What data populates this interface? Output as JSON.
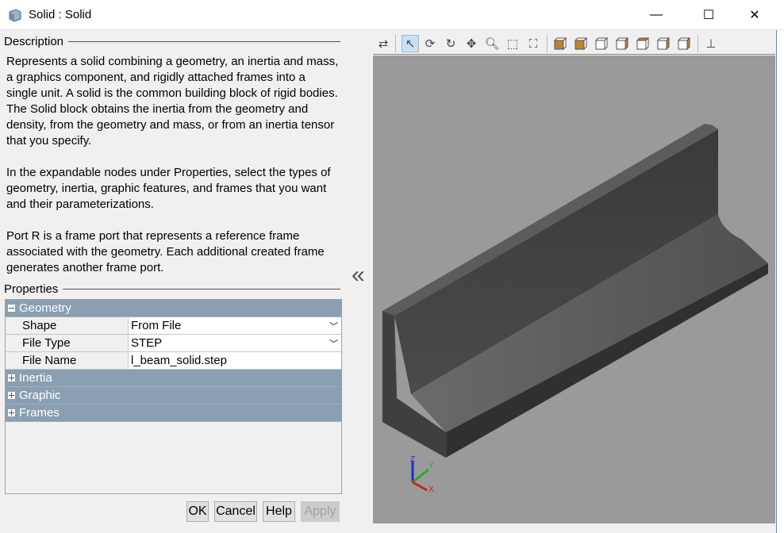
{
  "window": {
    "title": "Solid : Solid",
    "minimize": "—",
    "maximize": "☐",
    "close": "✕"
  },
  "description": {
    "heading": "Description",
    "paragraphs": [
      "Represents a solid combining a geometry, an inertia and mass, a graphics component, and rigidly attached frames into a single unit. A solid is the common building block of rigid bodies. The Solid block obtains the inertia from the geometry and density, from the geometry and mass, or from an inertia tensor that you specify.",
      "In the expandable nodes under Properties, select the types of geometry, inertia, graphic features, and frames that you want and their parameterizations.",
      "Port R is a frame port that represents a reference frame associated with the geometry. Each additional created frame generates another frame port."
    ]
  },
  "properties": {
    "heading": "Properties",
    "geometry": {
      "label": "Geometry",
      "expanded": true,
      "rows": [
        {
          "key": "Shape",
          "value": "From File",
          "dropdown": true
        },
        {
          "key": "File Type",
          "value": "STEP",
          "dropdown": true
        },
        {
          "key": "File Name",
          "value": "l_beam_solid.step",
          "dropdown": false
        }
      ]
    },
    "groups": [
      "Inertia",
      "Graphic",
      "Frames"
    ]
  },
  "buttons": {
    "ok": "OK",
    "cancel": "Cancel",
    "help": "Help",
    "apply": "Apply"
  },
  "collapse_icon": "«",
  "toolbar": {
    "icons": [
      "swap-icon",
      "select-icon",
      "rotate-icon",
      "roll-icon",
      "pan-icon",
      "zoom-icon",
      "zoom-box-icon",
      "fit-to-view-icon",
      "front-view-icon",
      "back-view-icon",
      "left-view-icon",
      "right-view-icon",
      "top-view-icon",
      "bottom-view-icon",
      "isometric-view-icon",
      "axis-triad-icon"
    ],
    "active": "select-icon"
  },
  "triad": {
    "x": "X",
    "y": "Y",
    "z": "Z"
  },
  "colors": {
    "group_header": "#8a9fb2",
    "canvas": "#9a9a9a",
    "view_cube": "#c0822a"
  }
}
